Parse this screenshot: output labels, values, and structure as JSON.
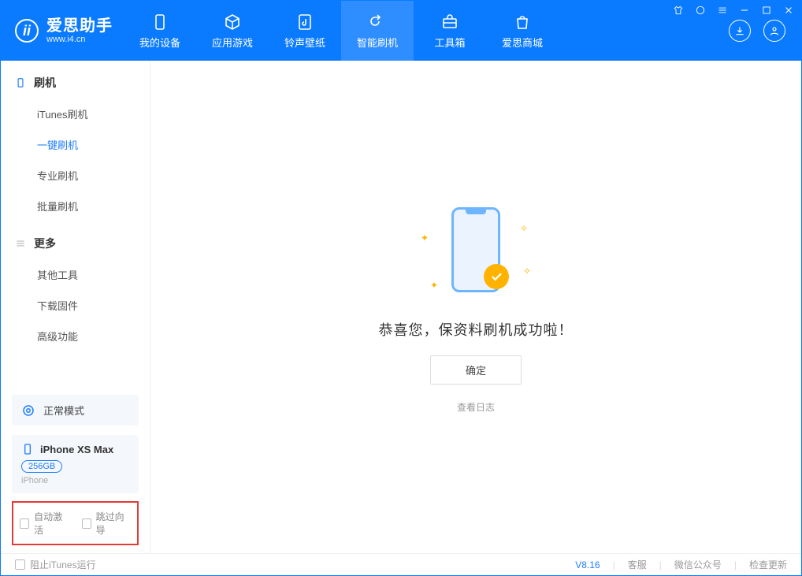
{
  "app": {
    "name_cn": "爱思助手",
    "domain": "www.i4.cn"
  },
  "nav": [
    {
      "label": "我的设备",
      "icon": "device-icon"
    },
    {
      "label": "应用游戏",
      "icon": "cube-icon"
    },
    {
      "label": "铃声壁纸",
      "icon": "music-icon"
    },
    {
      "label": "智能刷机",
      "icon": "refresh-icon",
      "active": true
    },
    {
      "label": "工具箱",
      "icon": "toolbox-icon"
    },
    {
      "label": "爱思商城",
      "icon": "bag-icon"
    }
  ],
  "sidebar": {
    "group1_label": "刷机",
    "group1_items": [
      {
        "label": "iTunes刷机"
      },
      {
        "label": "一键刷机",
        "active": true
      },
      {
        "label": "专业刷机"
      },
      {
        "label": "批量刷机"
      }
    ],
    "group2_label": "更多",
    "group2_items": [
      {
        "label": "其他工具"
      },
      {
        "label": "下载固件"
      },
      {
        "label": "高级功能"
      }
    ],
    "mode_label": "正常模式",
    "device": {
      "name": "iPhone XS Max",
      "storage": "256GB",
      "type": "iPhone"
    },
    "opt_auto_activate": "自动激活",
    "opt_skip_guide": "跳过向导"
  },
  "main": {
    "success_msg": "恭喜您，保资料刷机成功啦！",
    "ok_label": "确定",
    "log_link": "查看日志"
  },
  "footer": {
    "block_itunes": "阻止iTunes运行",
    "version": "V8.16",
    "links": [
      "客服",
      "微信公众号",
      "检查更新"
    ]
  }
}
